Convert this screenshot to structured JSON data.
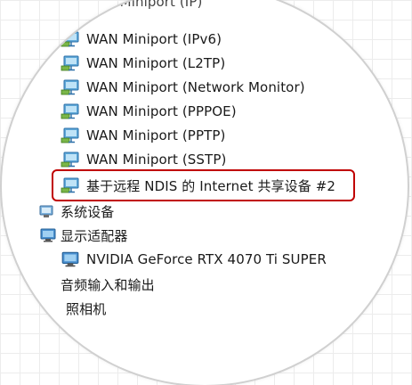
{
  "device_tree": {
    "partial_top_label": "WAN Miniport (IP)",
    "network_adapters": [
      {
        "label": "WAN Miniport (IPv6)"
      },
      {
        "label": "WAN Miniport (L2TP)"
      },
      {
        "label": "WAN Miniport (Network Monitor)"
      },
      {
        "label": "WAN Miniport (PPPOE)"
      },
      {
        "label": "WAN Miniport (PPTP)"
      },
      {
        "label": "WAN Miniport (SSTP)"
      },
      {
        "label": "基于远程 NDIS 的 Internet 共享设备 #2"
      }
    ],
    "system_devices": {
      "label": "系统设备"
    },
    "display_adapters": {
      "label": "显示适配器"
    },
    "gpu": {
      "label": "NVIDIA GeForce RTX 4070 Ti SUPER"
    },
    "audio": {
      "label": "音频输入和输出"
    },
    "camera": {
      "label": "照相机"
    }
  },
  "highlight_color": "#c00000",
  "icons": {
    "network": "network-adapter-icon",
    "system": "system-devices-icon",
    "display": "display-adapter-icon"
  }
}
